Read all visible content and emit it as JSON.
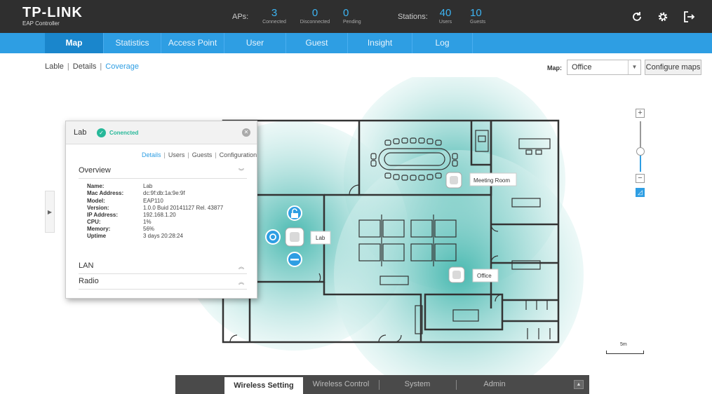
{
  "app": {
    "brand": "TP-LINK",
    "subtitle": "EAP Controller"
  },
  "stats": {
    "aps_label": "APs:",
    "connected": {
      "value": "3",
      "label": "Connected"
    },
    "disconnected": {
      "value": "0",
      "label": "Disconnected"
    },
    "pending": {
      "value": "0",
      "label": "Pending"
    },
    "stations_label": "Stations:",
    "users": {
      "value": "40",
      "label": "Users"
    },
    "guests": {
      "value": "10",
      "label": "Guests"
    }
  },
  "top_icons": [
    "refresh-icon",
    "settings-icon",
    "logout-icon"
  ],
  "nav": {
    "items": [
      "Map",
      "Statistics",
      "Access Point",
      "User",
      "Guest",
      "Insight",
      "Log"
    ],
    "active": "Map"
  },
  "subtabs": {
    "items": [
      "Lable",
      "Details",
      "Coverage"
    ],
    "active": "Coverage"
  },
  "map_selector": {
    "label": "Map:",
    "value": "Office",
    "configure_label": "Configure maps"
  },
  "aps": [
    {
      "name": "Meeting Room"
    },
    {
      "name": "Lab"
    },
    {
      "name": "Office"
    }
  ],
  "panel": {
    "title": "Lab",
    "status": "Conencted",
    "tabs": [
      "Details",
      "Users",
      "Guests",
      "Configuration"
    ],
    "active_tab": "Details",
    "overview_title": "Overview",
    "fields": [
      {
        "key": "Name:",
        "value": "Lab"
      },
      {
        "key": "Mac Address:",
        "value": "dc:9f:db:1a:9e:9f"
      },
      {
        "key": "Model:",
        "value": "EAP110"
      },
      {
        "key": "Version:",
        "value": "1.0.0 Buid 20141127 Rel. 43877"
      },
      {
        "key": "IP Address:",
        "value": "192.168.1.20"
      },
      {
        "key": "CPU:",
        "value": "1%"
      },
      {
        "key": "Memory:",
        "value": "56%"
      },
      {
        "key": "Uptime",
        "value": "3 days 20:28:24"
      }
    ],
    "lan_title": "LAN",
    "radio_title": "Radio"
  },
  "scale": {
    "label": "5m"
  },
  "bottom_tabs": {
    "items": [
      "Wireless Setting",
      "Wireless Control",
      "System",
      "Admin"
    ],
    "active": "Wireless Setting"
  },
  "colors": {
    "accent": "#2e9ee3",
    "topbar": "#2f2f2f",
    "connected": "#27b899",
    "coverage": "#8fd3cf"
  }
}
